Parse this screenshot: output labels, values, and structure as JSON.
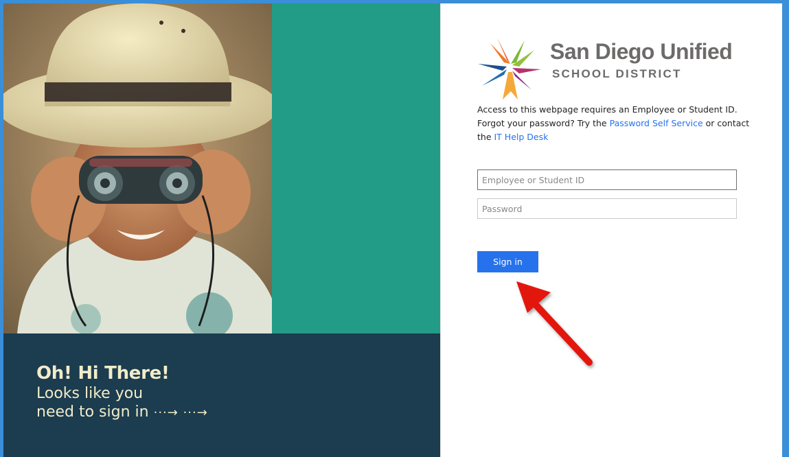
{
  "greeting": {
    "headline": "Oh! Hi There!",
    "line1": "Looks like you",
    "line2": "need to sign in",
    "arrows": "···→ ···→"
  },
  "logo": {
    "name": "San Diego Unified",
    "subtitle": "SCHOOL DISTRICT"
  },
  "intro": {
    "text_before": "Access to this webpage requires an Employee or Student ID. Forgot your password? Try the ",
    "password_link": "Password Self Service",
    "text_middle": " or contact the ",
    "helpdesk_link": "IT Help Desk"
  },
  "form": {
    "username_placeholder": "Employee or Student ID",
    "password_placeholder": "Password",
    "username_value": "",
    "password_value": "",
    "submit_label": "Sign in"
  },
  "colors": {
    "frame_border": "#3b8fd8",
    "teal": "#229b87",
    "navy": "#1c3c4f",
    "greeting_text": "#f2ecc9",
    "link": "#2672ec",
    "button": "#2672ec",
    "annotation_arrow": "#e3120b"
  },
  "icons": {
    "logo_mark": "sdusd-star-logo-icon",
    "annotation": "red-pointer-arrow-icon"
  }
}
